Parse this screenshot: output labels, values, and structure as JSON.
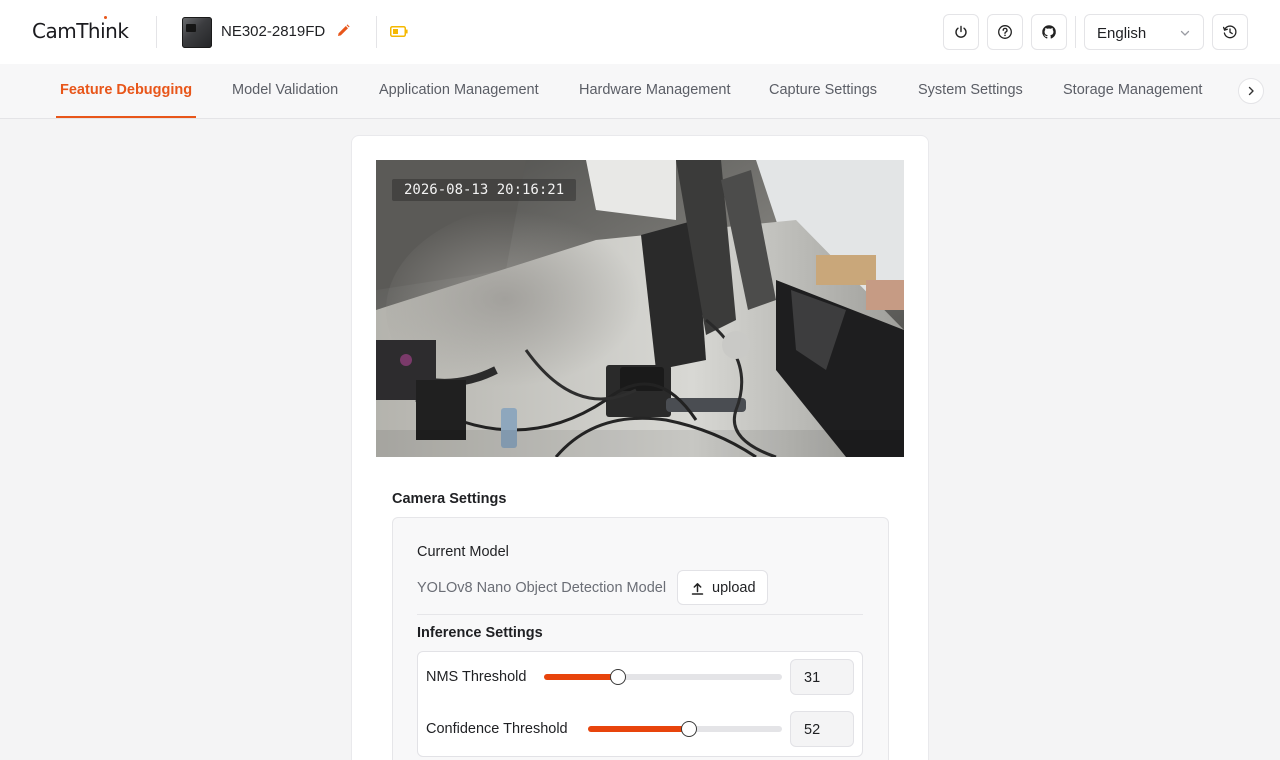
{
  "header": {
    "logo_text": "CamThink",
    "device_name": "NE302-2819FD",
    "language": "English",
    "icons": [
      "power-icon",
      "help-icon",
      "github-icon",
      "history-icon"
    ],
    "accent_color": "#e8561a",
    "battery_color": "#f5b800"
  },
  "tabs": [
    {
      "label": "Feature Debugging",
      "active": true
    },
    {
      "label": "Model Validation",
      "active": false
    },
    {
      "label": "Application Management",
      "active": false
    },
    {
      "label": "Hardware Management",
      "active": false
    },
    {
      "label": "Capture Settings",
      "active": false
    },
    {
      "label": "System Settings",
      "active": false
    },
    {
      "label": "Storage Management",
      "active": false
    }
  ],
  "preview": {
    "timestamp": "2026-08-13 20:16:21"
  },
  "camera_settings": {
    "title": "Camera Settings",
    "current_model_label": "Current Model",
    "model_name": "YOLOv8 Nano Object Detection Model",
    "upload_label": "upload",
    "inference_title": "Inference Settings",
    "nms": {
      "label": "NMS Threshold",
      "value": "31",
      "percent": 31
    },
    "confidence": {
      "label": "Confidence Threshold",
      "value": "52",
      "percent": 52
    }
  }
}
